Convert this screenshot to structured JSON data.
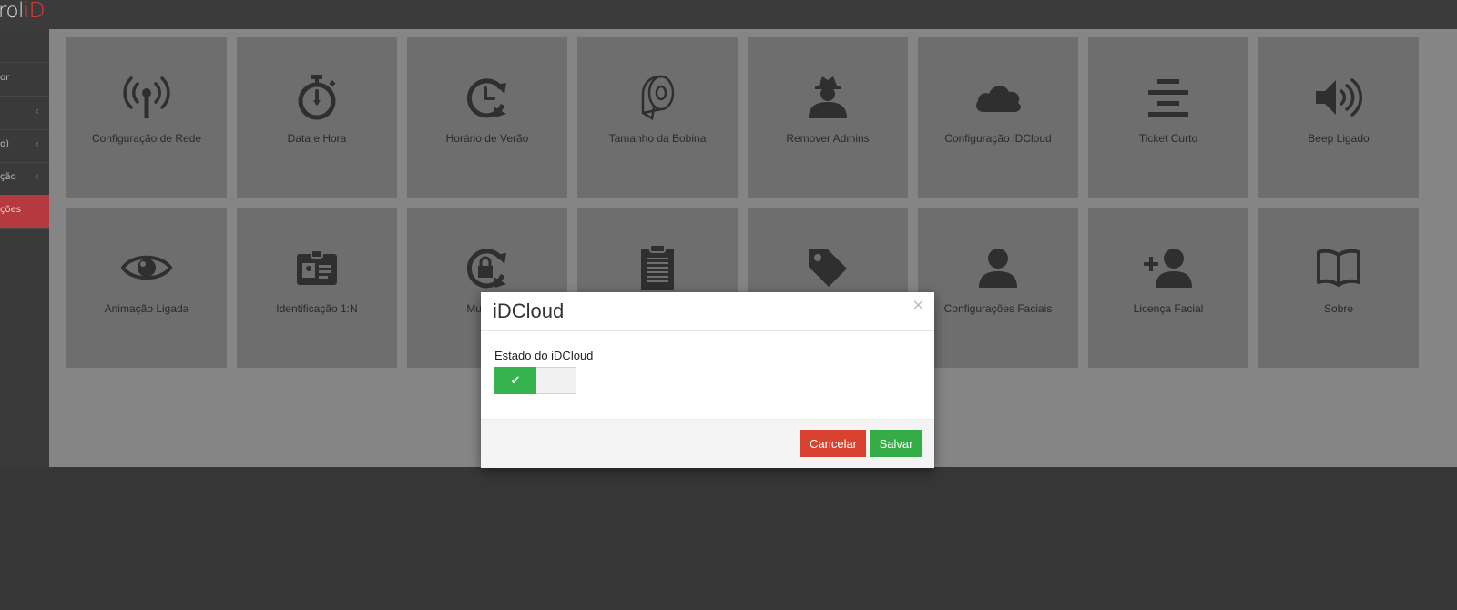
{
  "app": {
    "logo_text": "rol",
    "logo_accent": "iD"
  },
  "sidebar": {
    "items": [
      {
        "label": ""
      },
      {
        "label": "or"
      },
      {
        "label": ""
      },
      {
        "label": "o)"
      },
      {
        "label": "ção"
      },
      {
        "label": "ções"
      }
    ]
  },
  "tiles": [
    {
      "label": "Configuração de Rede",
      "icon": "antenna-icon"
    },
    {
      "label": "Data e Hora",
      "icon": "stopwatch-icon"
    },
    {
      "label": "Horário de Verão",
      "icon": "clock-arrow-icon"
    },
    {
      "label": "Tamanho da Bobina",
      "icon": "paper-roll-icon"
    },
    {
      "label": "Remover Admins",
      "icon": "admin-user-icon"
    },
    {
      "label": "Configuração iDCloud",
      "icon": "cloud-icon"
    },
    {
      "label": "Ticket Curto",
      "icon": "align-center-icon"
    },
    {
      "label": "Beep Ligado",
      "icon": "speaker-icon"
    },
    {
      "label": "Animação Ligada",
      "icon": "eye-icon"
    },
    {
      "label": "Identificação 1:N",
      "icon": "id-card-icon"
    },
    {
      "label": "Mudar S",
      "icon": "lock-rotate-icon"
    },
    {
      "label": "",
      "icon": "clipboard-icon"
    },
    {
      "label": "",
      "icon": "tag-icon"
    },
    {
      "label": "Configurações Faciais",
      "icon": "user-icon"
    },
    {
      "label": "Licença Facial",
      "icon": "add-user-icon"
    },
    {
      "label": "Sobre",
      "icon": "book-icon"
    }
  ],
  "modal": {
    "title": "iDCloud",
    "close_label": "×",
    "field_label": "Estado do iDCloud",
    "toggle_state": "on",
    "toggle_on_label": "✔",
    "cancel_label": "Cancelar",
    "save_label": "Salvar"
  },
  "colors": {
    "accent_red": "#d9422f",
    "accent_green": "#34ad46",
    "sidebar_active": "#b43a3f"
  }
}
